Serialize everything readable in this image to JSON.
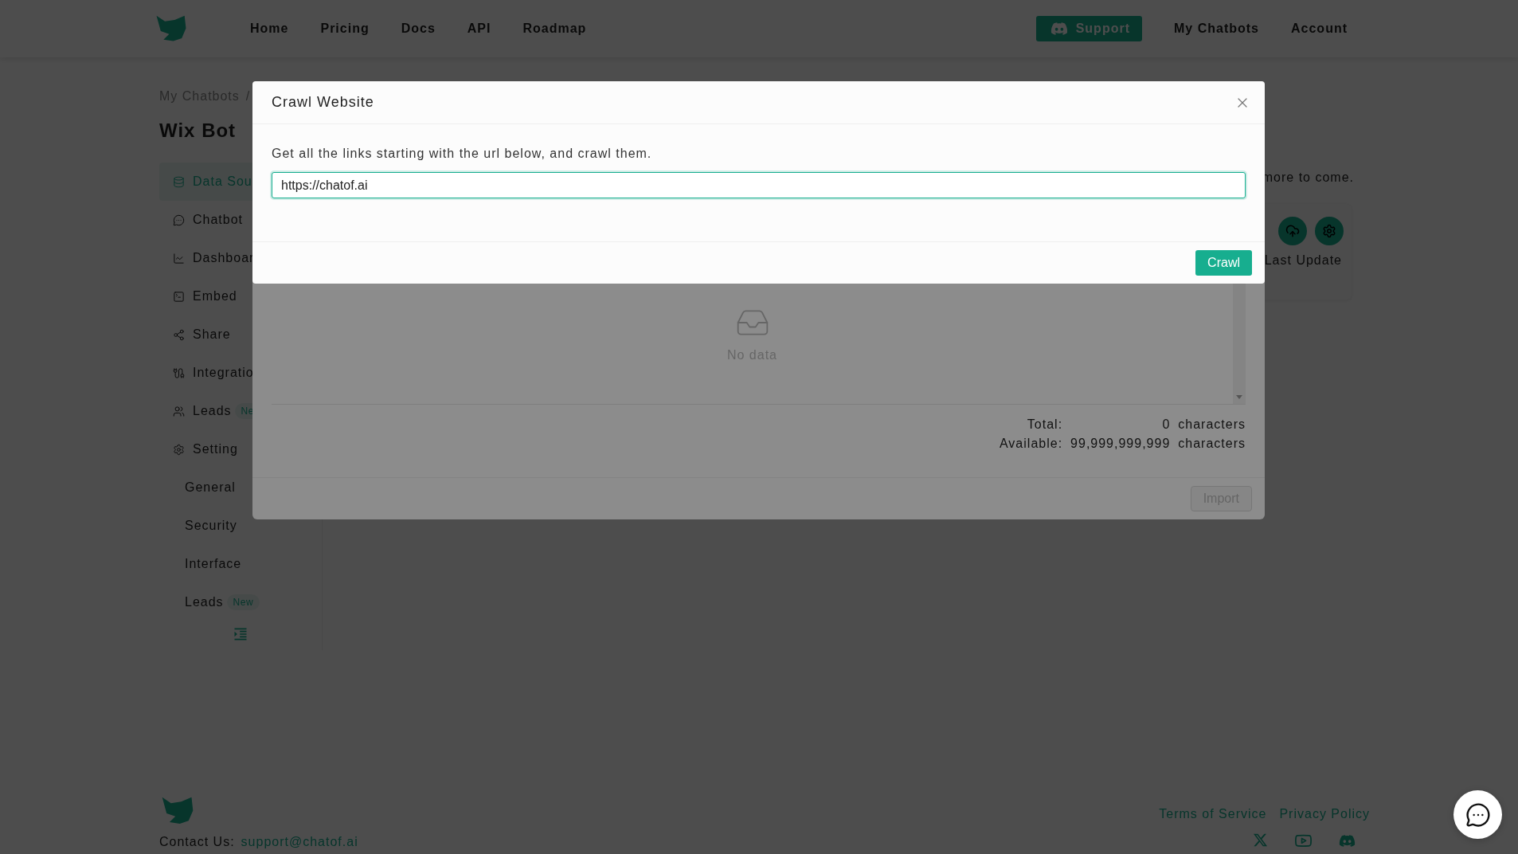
{
  "nav": {
    "links": [
      {
        "label": "Home"
      },
      {
        "label": "Pricing"
      },
      {
        "label": "Docs"
      },
      {
        "label": "API"
      },
      {
        "label": "Roadmap"
      }
    ],
    "support": "Support",
    "right_links": [
      {
        "label": "My Chatbots"
      },
      {
        "label": "Account"
      }
    ]
  },
  "breadcrumb": {
    "item": "My Chatbots",
    "separator": "/"
  },
  "title": "Wix Bot",
  "sidebar": {
    "items": [
      {
        "label": "Data Sou",
        "selected": true
      },
      {
        "label": "Chatbot",
        "selected": false
      },
      {
        "label": "Dashboar",
        "selected": false
      },
      {
        "label": "Embed",
        "selected": false
      },
      {
        "label": "Share",
        "selected": false
      },
      {
        "label": "Integratio",
        "selected": false
      },
      {
        "label": "Leads",
        "badge": "Ne",
        "selected": false
      },
      {
        "label": "Setting",
        "selected": false,
        "children": [
          {
            "label": "General",
            "selected": false
          },
          {
            "label": "Security",
            "selected": false
          },
          {
            "label": "Interface",
            "selected": false
          },
          {
            "label": "Leads",
            "badge": "New",
            "selected": false
          }
        ]
      }
    ]
  },
  "intro_text": "more to come.",
  "source_card": {
    "label": "Last Update"
  },
  "import_dialog": {
    "empty_text": "No data",
    "totals": [
      {
        "label": "Total:",
        "value": "0",
        "unit": "characters"
      },
      {
        "label": "Available:",
        "value": "99,999,999,999",
        "unit": "characters"
      }
    ],
    "import_button": {
      "label": "Import",
      "disabled": true
    }
  },
  "crawl_dialog": {
    "title": "Crawl Website",
    "description": "Get all the links starting with the url below, and crawl them.",
    "url_value": "https://chatof.ai",
    "crawl_button": "Crawl"
  },
  "footer": {
    "contact_label": "Contact Us:",
    "email": "support@chatof.ai",
    "links": [
      {
        "label": "Terms of Service"
      },
      {
        "label": "Privacy Policy"
      }
    ]
  }
}
